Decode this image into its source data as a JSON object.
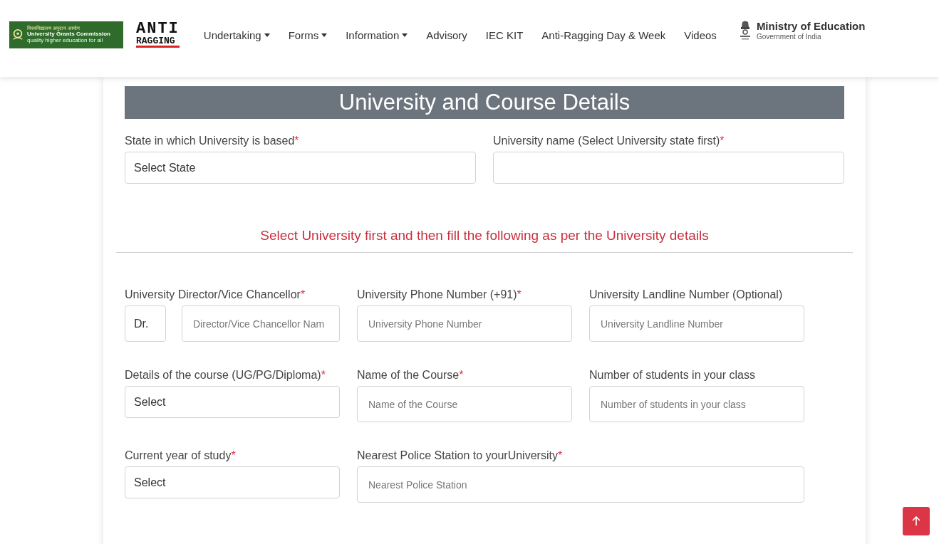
{
  "header": {
    "ugc_logo": {
      "hindi": "विश्वविद्यालय अनुदान आयोग",
      "name": "University Grants Commission",
      "tagline": "quality higher education for all"
    },
    "site_logo": {
      "line_1": "ANTI",
      "line_2": "RAGGING"
    },
    "nav": [
      {
        "label": "Undertaking",
        "dropdown": true
      },
      {
        "label": "Forms",
        "dropdown": true
      },
      {
        "label": "Information",
        "dropdown": true
      },
      {
        "label": "Advisory",
        "dropdown": false
      },
      {
        "label": "IEC KIT",
        "dropdown": false
      },
      {
        "label": "Anti-Ragging Day & Week",
        "dropdown": false
      },
      {
        "label": "Videos",
        "dropdown": false
      }
    ],
    "ministry_logo": {
      "name": "Ministry of Education",
      "subtitle": "Government of India"
    }
  },
  "form": {
    "title": "University and Course Details",
    "top_fields": [
      {
        "kind": "select",
        "label": "State in which University is based",
        "required_mark": "*",
        "value": "Select State"
      },
      {
        "kind": "input",
        "label": "University name (Select University state first)",
        "required_mark": "*"
      }
    ],
    "note": "Select University first and then fill the following as per the University details",
    "rows": [
      {
        "fields": [
          {
            "kind": "title-name",
            "label": "University Director/Vice Chancellor",
            "required_mark": "*",
            "value": "Dr.",
            "placeholder": "Director/Vice Chancellor Nam",
            "wide": false
          },
          {
            "kind": "input",
            "label": "University Phone Number (+91)",
            "required_mark": "*",
            "placeholder": "University Phone Number",
            "wide": false
          },
          {
            "kind": "input",
            "label": "University Landline Number (Optional)",
            "placeholder": "University Landline Number",
            "wide": false
          }
        ]
      },
      {
        "fields": [
          {
            "kind": "select",
            "label": "Details of the course (UG/PG/Diploma)",
            "required_mark": "*",
            "value": "Select",
            "wide": false
          },
          {
            "kind": "input",
            "label": "Name of the Course",
            "required_mark": "*",
            "placeholder": "Name of the Course",
            "wide": false
          },
          {
            "kind": "input",
            "label": "Number of students in your class",
            "placeholder": "Number of students in your class",
            "wide": false
          }
        ]
      },
      {
        "fields": [
          {
            "kind": "select",
            "label": "Current year of study",
            "required_mark": "*",
            "value": "Select",
            "wide": false
          },
          {
            "kind": "input",
            "label": "Nearest Police Station to yourUniversity",
            "required_mark": "*",
            "placeholder": "Nearest Police Station",
            "wide": true
          }
        ]
      }
    ]
  }
}
